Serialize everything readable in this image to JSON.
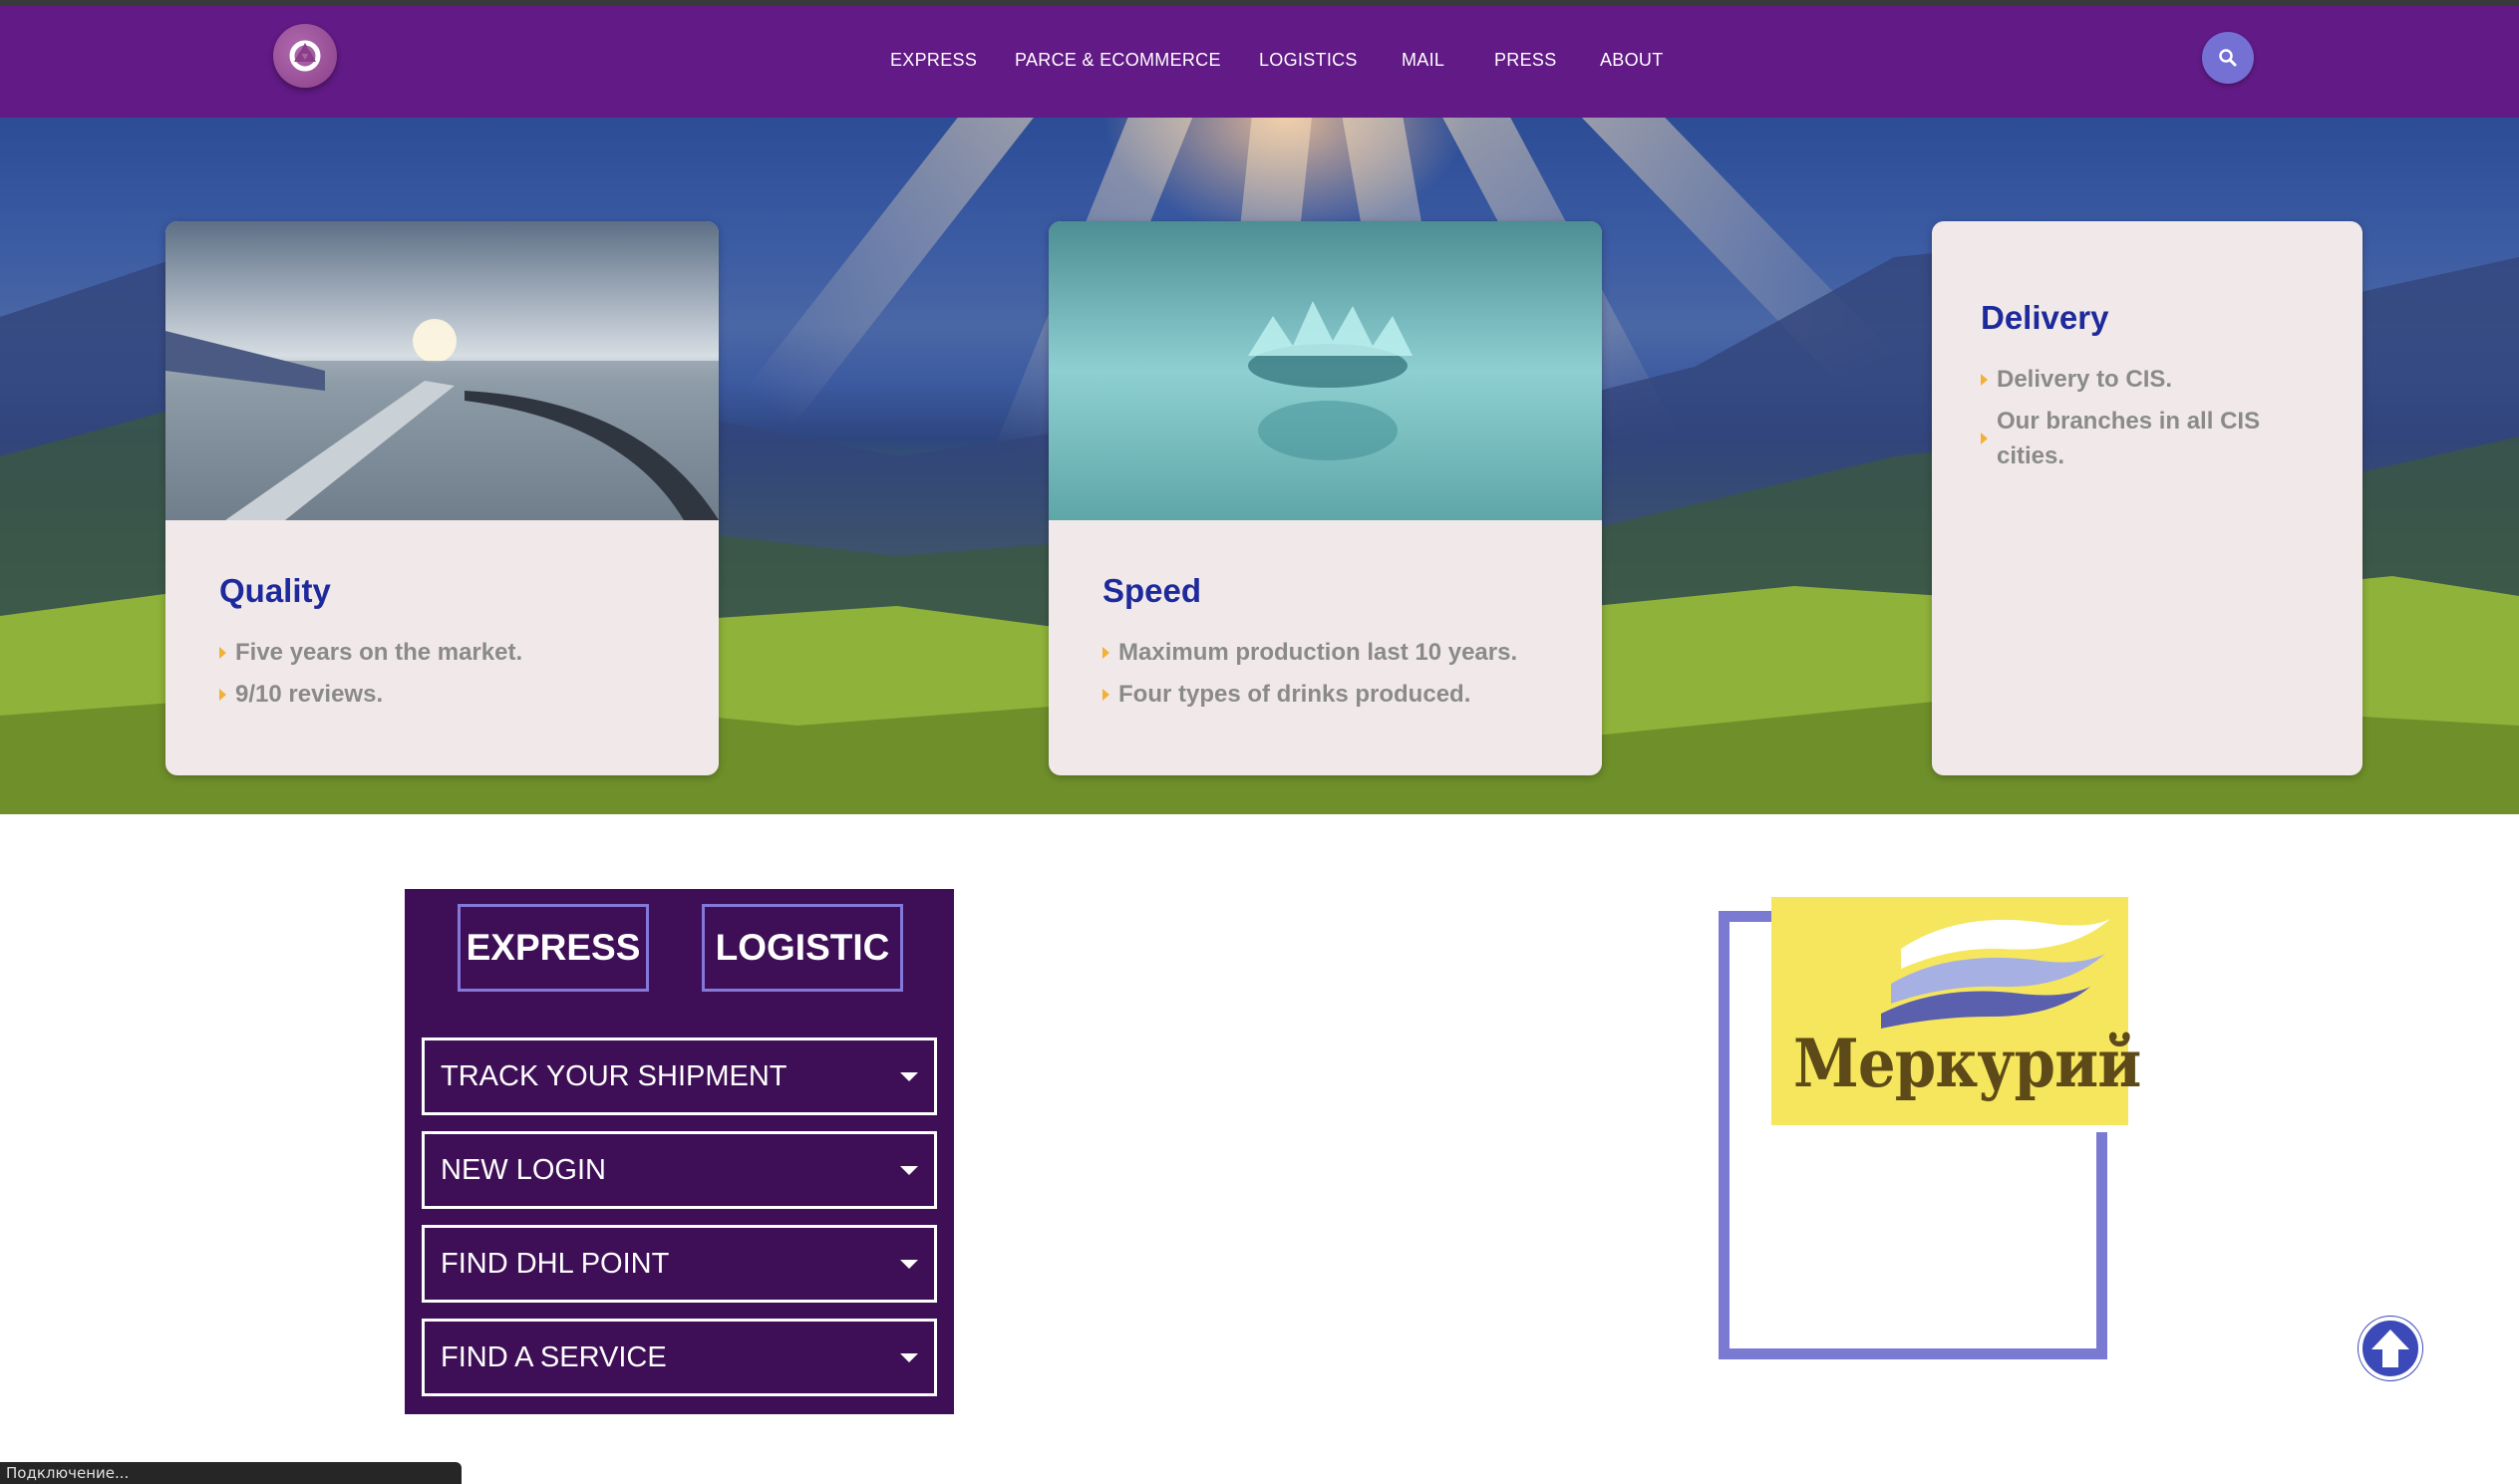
{
  "nav": {
    "items": [
      {
        "label": "EXPRESS"
      },
      {
        "label": "PARCE & ECOMMERCE"
      },
      {
        "label": "LOGISTICS"
      },
      {
        "label": "MAIL"
      },
      {
        "label": "PRESS"
      },
      {
        "label": "ABOUT"
      }
    ]
  },
  "icons": {
    "logo": "logo-mark",
    "search": "search-icon",
    "scroll_top": "arrow-up-circle-icon"
  },
  "colors": {
    "header": "#621a86",
    "card_title": "#1e2a9c",
    "bullet": "#f2b136",
    "panel": "#3e0f56",
    "frame": "#7b7ad2",
    "brand_bg": "#f5e65e"
  },
  "cards": [
    {
      "title": "Quality",
      "items": [
        "Five years on the market.",
        "9/10 reviews."
      ]
    },
    {
      "title": "Speed",
      "items": [
        "Maximum production last 10 years.",
        "Four types of drinks produced."
      ]
    },
    {
      "title": "Delivery",
      "items": [
        "Delivery to CIS.",
        "Our branches in all CIS cities."
      ]
    }
  ],
  "panel": {
    "tabs": [
      {
        "label": "EXPRESS"
      },
      {
        "label": "LOGISTIC"
      }
    ],
    "dropdowns": [
      {
        "label": "TRACK YOUR SHIPMENT"
      },
      {
        "label": "NEW LOGIN"
      },
      {
        "label": "FIND DHL POINT"
      },
      {
        "label": "FIND A SERVICE"
      }
    ]
  },
  "brand": {
    "name": "Меркурий"
  },
  "status": {
    "text": "Подключение..."
  }
}
